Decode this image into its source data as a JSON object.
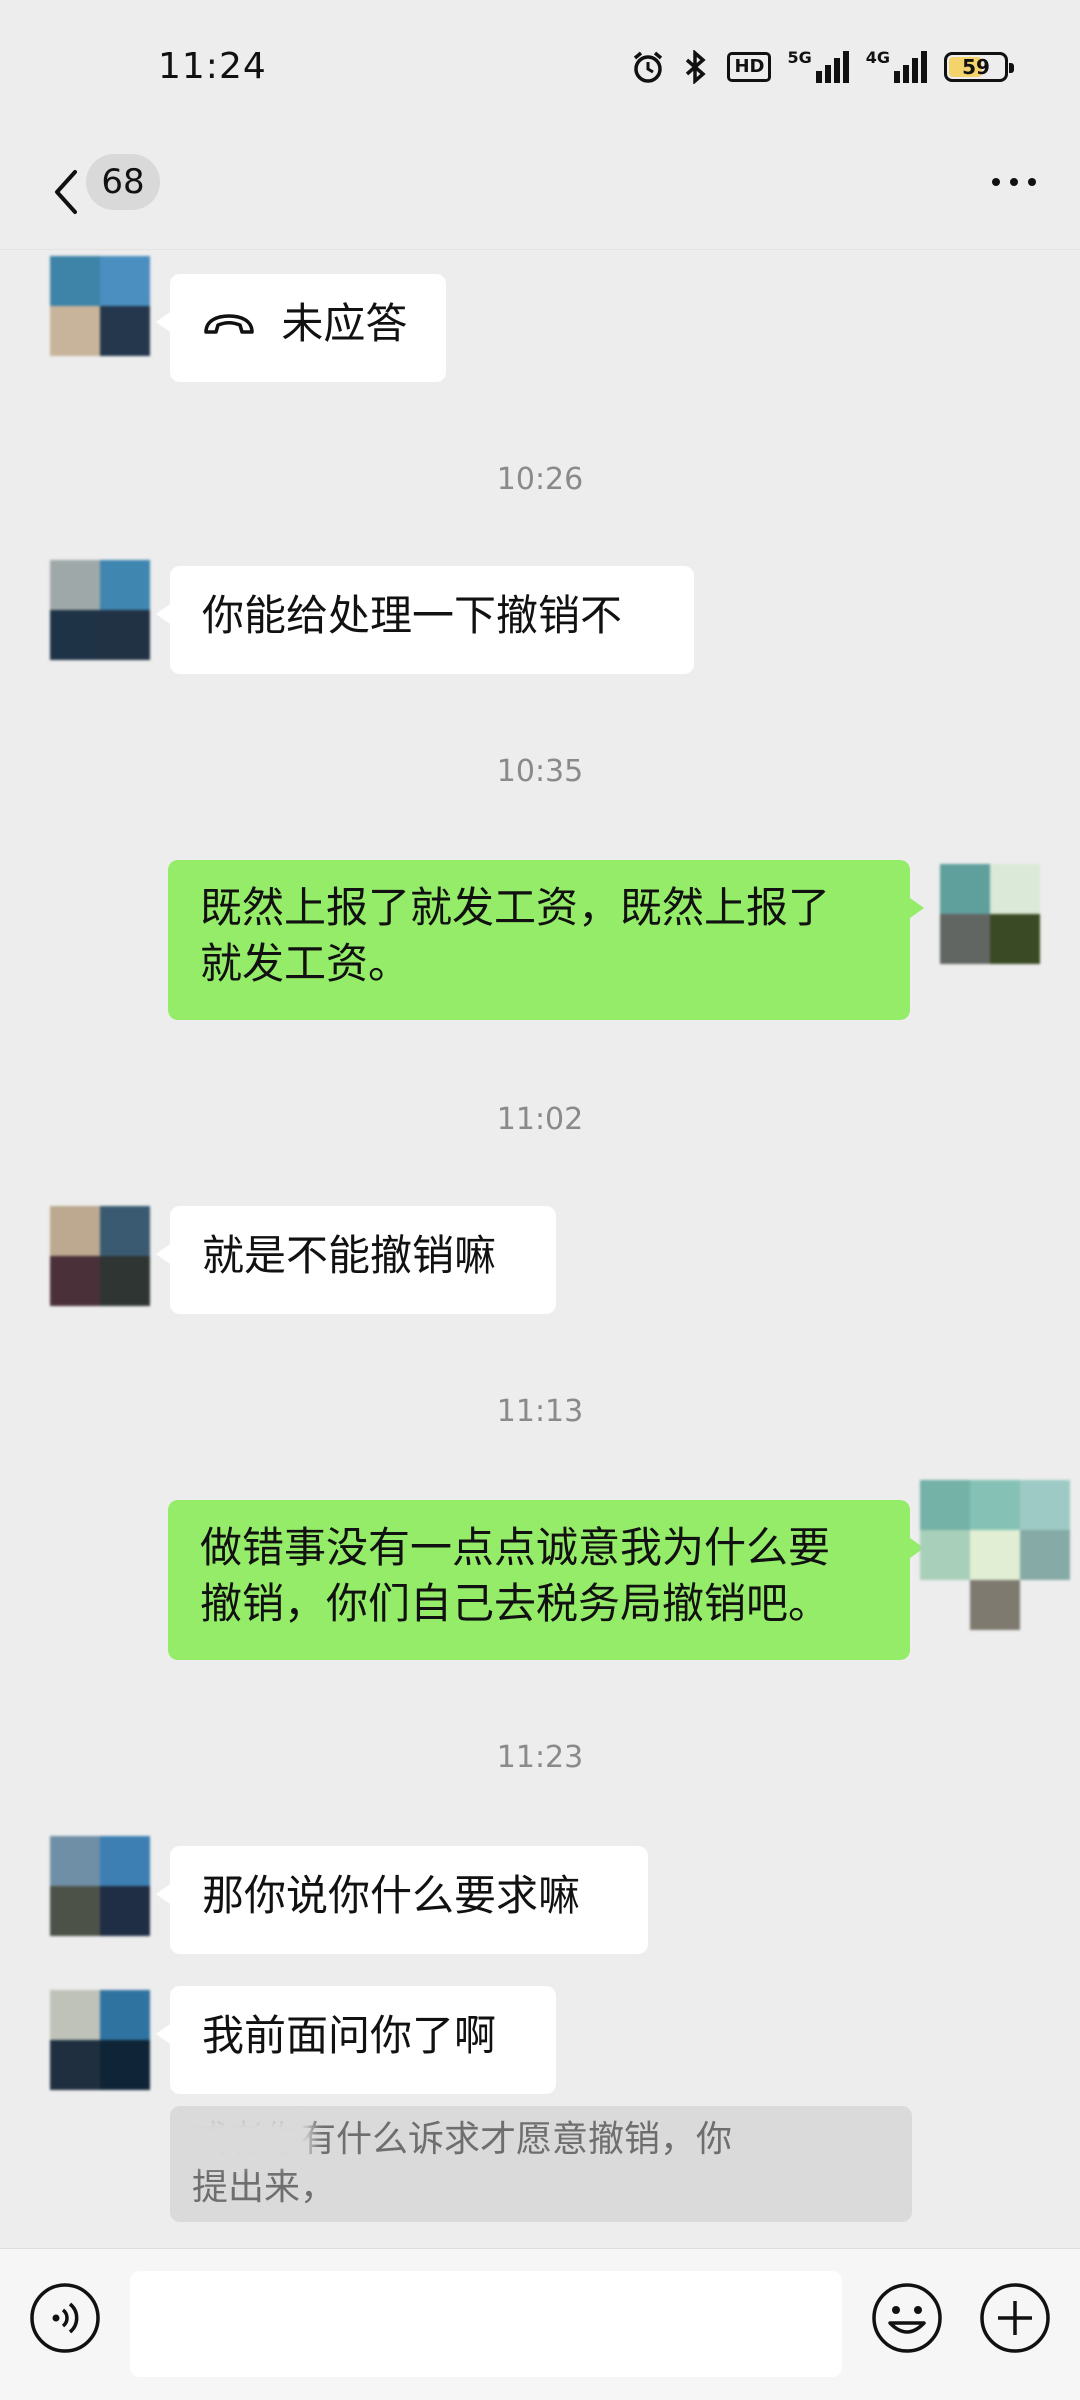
{
  "status_bar": {
    "time": "11:24",
    "icons": [
      "alarm-icon",
      "bluetooth-icon",
      "hd-icon",
      "signal-5g-icon",
      "signal-4g-icon",
      "battery-icon"
    ],
    "hd_label": "HD",
    "net1_label": "5G",
    "net2_label": "4G",
    "battery_level": "59",
    "battery_color": "#f5d36b"
  },
  "header": {
    "unread_count": "68",
    "back_icon": "chevron-left-icon",
    "more_icon": "more-dots-icon"
  },
  "messages": [
    {
      "type": "in",
      "text": "未应答",
      "icon": "hangup-phone-icon"
    },
    {
      "type": "timestamp",
      "text": "10:26"
    },
    {
      "type": "in",
      "text": "你能给处理一下撤销不"
    },
    {
      "type": "timestamp",
      "text": "10:35"
    },
    {
      "type": "out",
      "lines": [
        "既然上报了就发工资，既然上报了",
        "就发工资。"
      ]
    },
    {
      "type": "timestamp",
      "text": "11:02"
    },
    {
      "type": "in",
      "text": "就是不能撤销嘛"
    },
    {
      "type": "timestamp",
      "text": "11:13"
    },
    {
      "type": "out",
      "lines": [
        "做错事没有一点点诚意我为什么要",
        "撤销，你们自己去税务局撤销吧。"
      ]
    },
    {
      "type": "timestamp",
      "text": "11:23"
    },
    {
      "type": "in",
      "text": "那你说你什么要求嘛"
    },
    {
      "type": "in",
      "text": "我前面问你了啊"
    }
  ],
  "draft": {
    "lines": [
      "或者你有什么诉求才愿意撤销，你",
      "提出来，"
    ]
  },
  "input_bar": {
    "voice_icon": "voice-icon",
    "emoji_icon": "emoji-icon",
    "plus_icon": "plus-icon",
    "input_value": ""
  },
  "colors": {
    "background": "#ededed",
    "incoming_bubble": "#ffffff",
    "outgoing_bubble": "#95ec69",
    "timestamp": "#8a8a8a"
  }
}
